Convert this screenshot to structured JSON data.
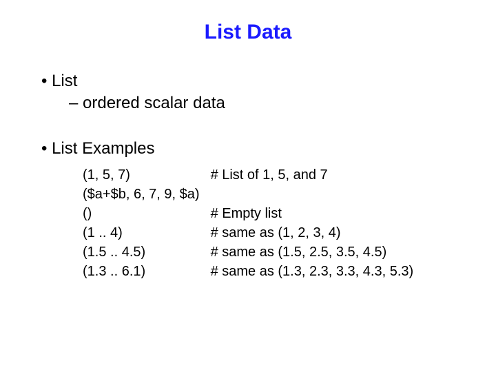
{
  "title": "List Data",
  "bullets": {
    "list": "List",
    "ordered": "ordered scalar data",
    "examples": "List Examples"
  },
  "examples": [
    {
      "left": "(1, 5, 7)",
      "right": "# List of 1, 5, and 7"
    },
    {
      "left": "($a+$b, 6, 7, 9, $a)",
      "right": ""
    },
    {
      "left": "()",
      "right": "# Empty list"
    },
    {
      "left": "(1 .. 4)",
      "right": "# same as (1, 2, 3, 4)"
    },
    {
      "left": "(1.5 .. 4.5)",
      "right": "# same as (1.5, 2.5, 3.5, 4.5)"
    },
    {
      "left": "(1.3 .. 6.1)",
      "right": "# same as (1.3, 2.3, 3.3, 4.3, 5.3)"
    }
  ]
}
